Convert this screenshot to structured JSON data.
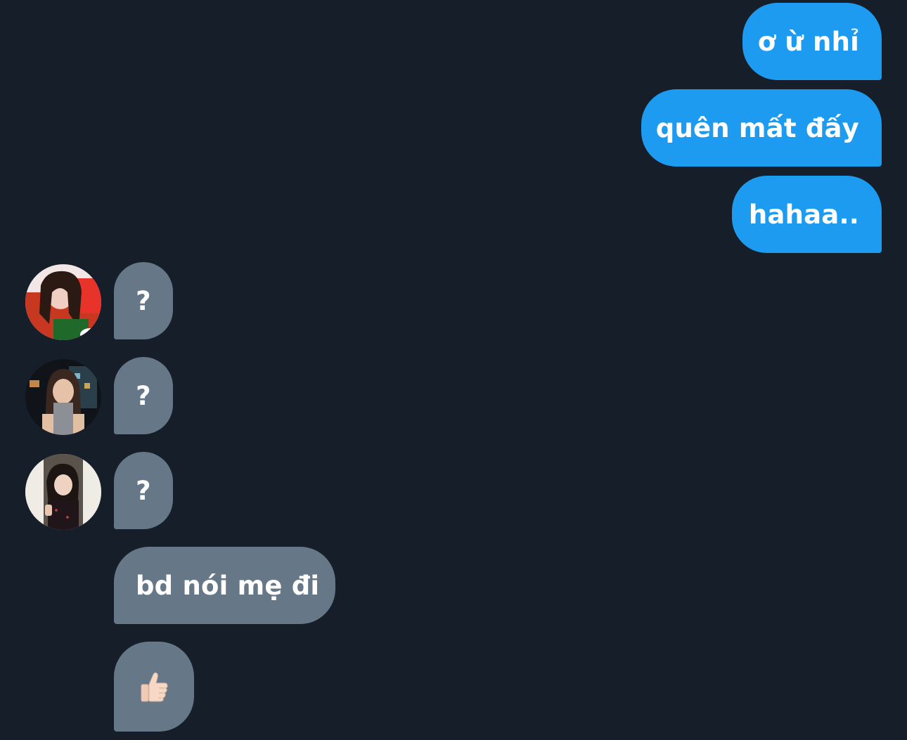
{
  "colors": {
    "background": "#161e29",
    "outgoing_bubble": "#1d9bf0",
    "incoming_bubble": "#667788",
    "text": "#ffffff"
  },
  "messages": [
    {
      "direction": "outgoing",
      "text": "ơ ừ nhỉ"
    },
    {
      "direction": "outgoing",
      "text": "quên mất đấy"
    },
    {
      "direction": "outgoing",
      "text": "hahaa.."
    },
    {
      "direction": "incoming",
      "text": "?",
      "avatar": "avatar-photo-1"
    },
    {
      "direction": "incoming",
      "text": "?",
      "avatar": "avatar-photo-2"
    },
    {
      "direction": "incoming",
      "text": "?",
      "avatar": "avatar-photo-3"
    },
    {
      "direction": "incoming",
      "text": "bd nói mẹ đi"
    },
    {
      "direction": "incoming",
      "icon": "thumbs-up-icon"
    }
  ]
}
